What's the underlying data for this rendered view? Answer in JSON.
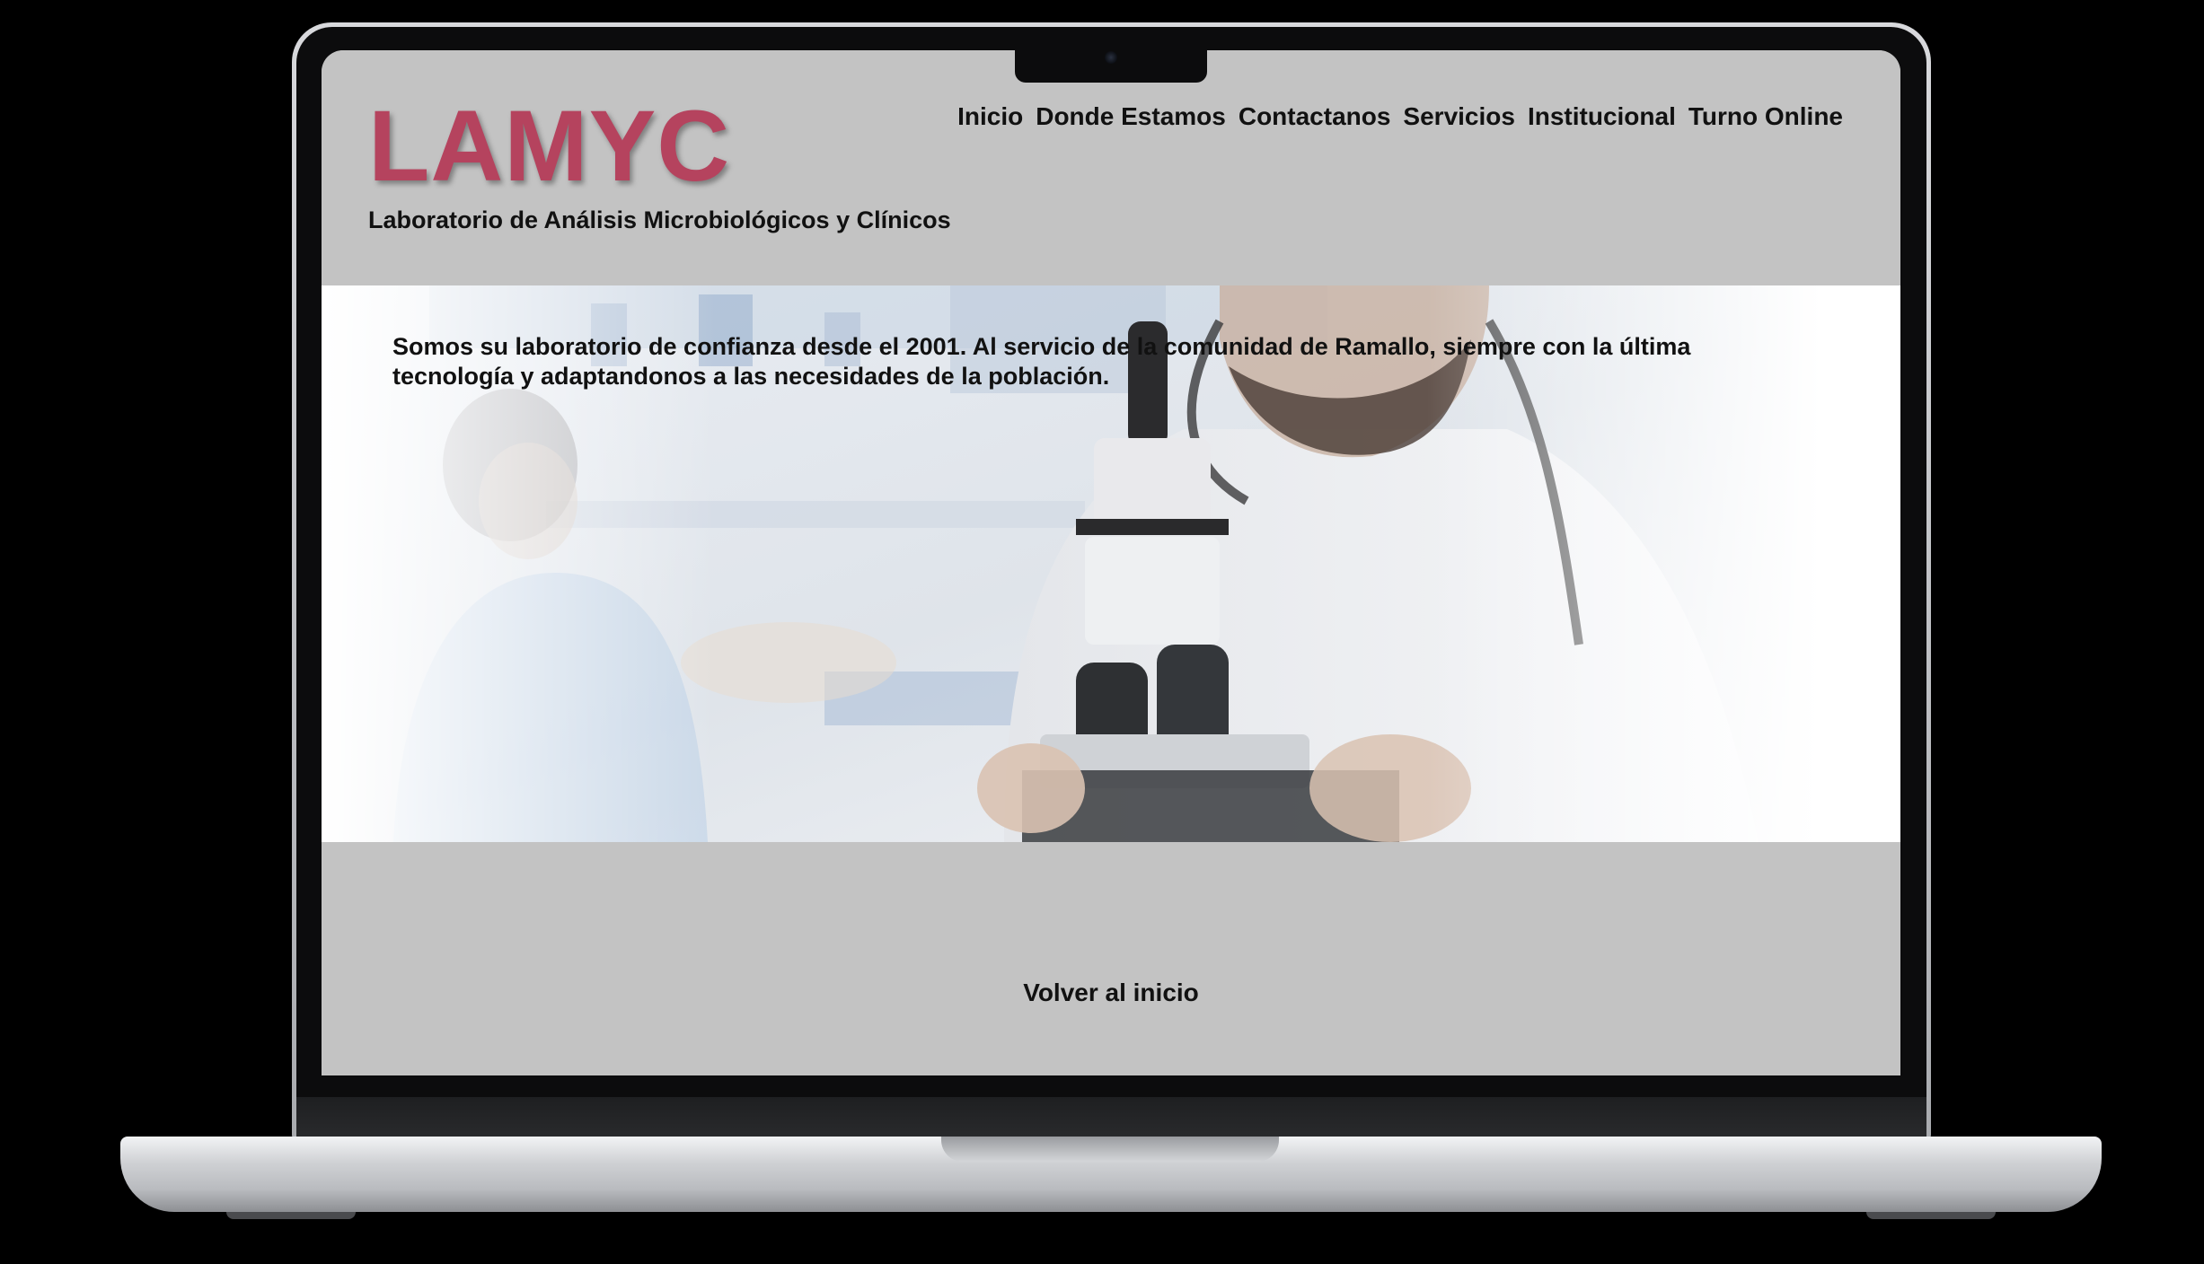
{
  "brand": {
    "logo": "LAMYC",
    "tagline": "Laboratorio de Análisis Microbiológicos y Clínicos",
    "logo_color": "#b5435e"
  },
  "nav": {
    "items": [
      {
        "label": "Inicio"
      },
      {
        "label": "Donde Estamos"
      },
      {
        "label": "Contactanos"
      },
      {
        "label": "Servicios"
      },
      {
        "label": "Institucional"
      },
      {
        "label": "Turno Online"
      }
    ]
  },
  "hero": {
    "text": "Somos su laboratorio de confianza desde el 2001. Al servicio de la comunidad de Ramallo, siempre con la última tecnología y adaptandonos a las necesidades de la población.",
    "image": "laboratory-microscope-photo"
  },
  "footer": {
    "back_link": "Volver al inicio"
  },
  "colors": {
    "header_bg": "#c3c3c3",
    "footer_bg": "#c3c3c3",
    "text": "#111111"
  }
}
